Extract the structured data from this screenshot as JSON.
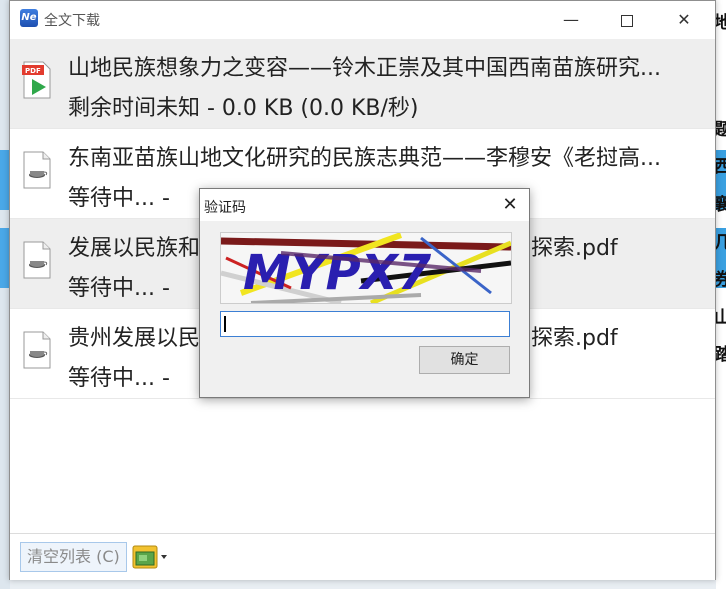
{
  "window": {
    "title": "全文下载",
    "app_icon_text": "Ne"
  },
  "downloads": [
    {
      "name": "山地民族想象力之变容——铃木正崇及其中国西南苗族研究...",
      "status": "剩余时间未知  -  0.0 KB (0.0 KB/秒)",
      "icon": "pdf-icon",
      "selected": true
    },
    {
      "name": "东南亚苗族山地文化研究的民族志典范——李穆安《老挝高...",
      "status": "等待中...  -",
      "icon": "generic-file-icon",
      "selected": false
    },
    {
      "name": "发展以民族和    展机制探索.pdf",
      "name_left": "发展以民族和",
      "name_right": "展机制探索.pdf",
      "status": "等待中...  -",
      "icon": "generic-file-icon",
      "selected": true
    },
    {
      "name": "贵州发展以民    思考与探索.pdf",
      "name_left": "贵州发展以民",
      "name_right": "思考与探索.pdf",
      "status": "等待中...  -",
      "icon": "generic-file-icon",
      "selected": false
    }
  ],
  "bottom": {
    "clear_label": "清空列表 (C)"
  },
  "dialog": {
    "title": "验证码",
    "captcha_text": "MYPX7",
    "input_value": "",
    "ok_label": "确定"
  },
  "background": {
    "right_glyphs": [
      "地",
      "题",
      "西",
      "襄",
      "几",
      "券",
      "山",
      "踏"
    ]
  },
  "colors": {
    "accent": "#3c7fd4",
    "captcha_text": "#2a1fb0"
  }
}
